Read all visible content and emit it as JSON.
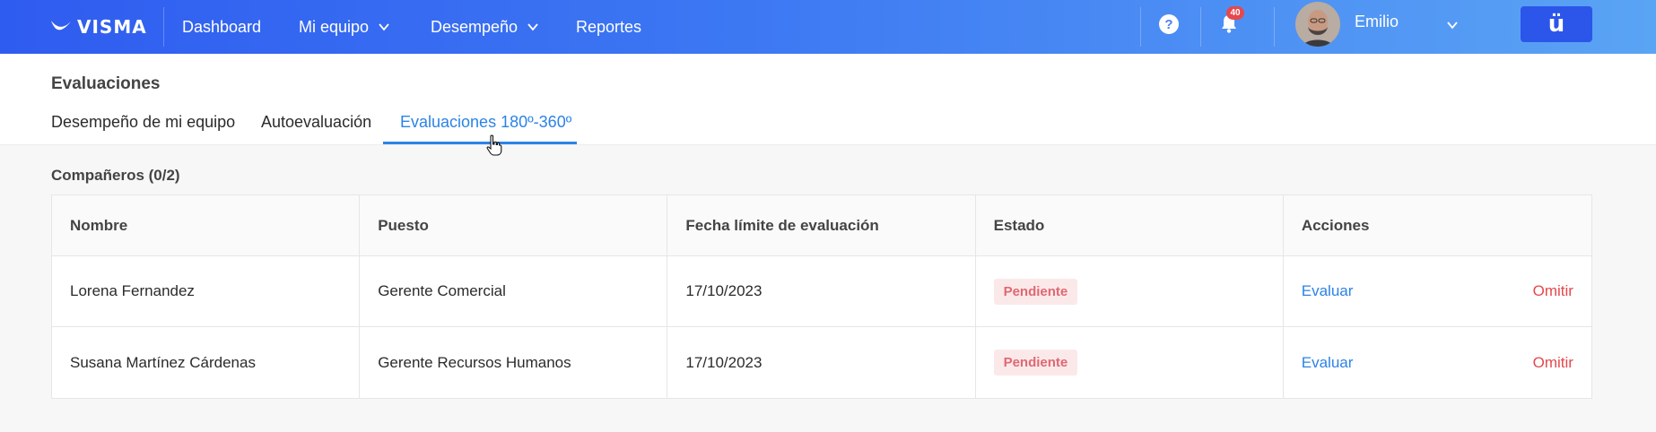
{
  "topbar": {
    "brand": "VISMA",
    "nav": [
      {
        "label": "Dashboard"
      },
      {
        "label": "Mi equipo"
      },
      {
        "label": "Desempeño"
      },
      {
        "label": "Reportes"
      }
    ],
    "help_glyph": "?",
    "notifications_count": "40",
    "user_name": "Emilio",
    "app_glyph": "ü",
    "colors": {
      "gradient_start": "#2f5cf0",
      "gradient_end": "#5aa4f4",
      "badge": "#e5484d"
    }
  },
  "header": {
    "title": "Evaluaciones",
    "tabs": [
      {
        "label": "Desempeño de mi equipo"
      },
      {
        "label": "Autoevaluación"
      },
      {
        "label": "Evaluaciones 180º-360º"
      }
    ],
    "active_tab": 2
  },
  "section": {
    "title": "Compañeros (0/2)"
  },
  "table": {
    "columns": [
      "Nombre",
      "Puesto",
      "Fecha límite de evaluación",
      "Estado",
      "Acciones"
    ],
    "rows": [
      {
        "nombre": "Lorena Fernandez",
        "puesto": "Gerente Comercial",
        "fecha": "17/10/2023",
        "estado": "Pendiente",
        "evaluar": "Evaluar",
        "omitir": "Omitir"
      },
      {
        "nombre": "Susana Martínez Cárdenas",
        "puesto": "Gerente Recursos Humanos",
        "fecha": "17/10/2023",
        "estado": "Pendiente",
        "evaluar": "Evaluar",
        "omitir": "Omitir"
      }
    ]
  },
  "colors": {
    "accent": "#2c83e6",
    "danger": "#e5484d",
    "pending_bg": "#fbe9ea",
    "pending_text": "#e06872"
  }
}
